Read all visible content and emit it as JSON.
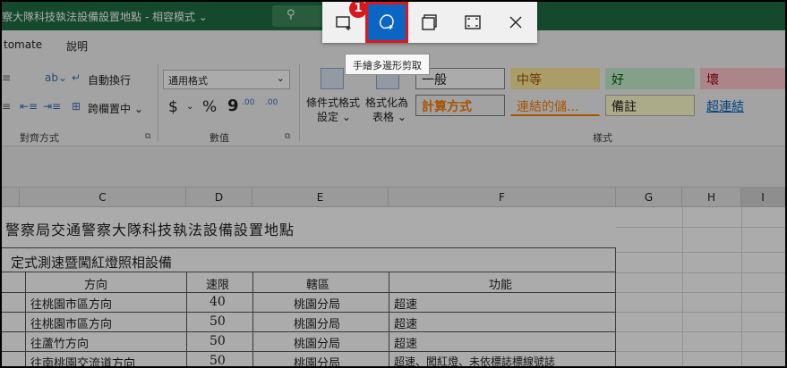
{
  "title_bar": {
    "title": "察大隊科技執法設備設置地點 - 相容模式 ⌄",
    "search_icon": "search-icon"
  },
  "menu": {
    "items": [
      "tomate",
      "說明"
    ]
  },
  "ribbon": {
    "align": {
      "wrap_text": "自動換行",
      "merge_center": "跨欄置中 ⌄",
      "group_label": "對齊方式"
    },
    "number": {
      "format_value": "通用格式",
      "currency": "$",
      "percent": "%",
      "comma": "9",
      "dec_inc": ".00",
      "dec_dec": ".00",
      "group_label": "數值"
    },
    "styles": {
      "cond_format": [
        "條件式格式",
        "設定 ⌄"
      ],
      "format_table": [
        "格式化為",
        "表格 ⌄"
      ],
      "normal": "一般",
      "neutral": "中等",
      "good": "好",
      "bad": "壞",
      "calculation": "計算方式",
      "linked_cell": "連結的儲...",
      "note": "備註",
      "hyperlink": "超連結",
      "group_label": "樣式"
    },
    "colors": {
      "neutral_bg": "#ffeb9c",
      "neutral_fg": "#9c5700",
      "good_bg": "#c6efce",
      "good_fg": "#006100",
      "bad_bg": "#ffc7ce",
      "bad_fg": "#9c0006",
      "calc_bg": "#f2f2f2",
      "calc_fg": "#fa7d00",
      "note_bg": "#ffffcc",
      "link_fg": "#0563c1"
    }
  },
  "snip_toolbar": {
    "tools": [
      "rectangle-snip-icon",
      "freeform-snip-icon",
      "window-snip-icon",
      "fullscreen-snip-icon",
      "close-icon"
    ],
    "badge": "1",
    "tooltip": "手繪多邊形剪取",
    "accent": "#0a66c2",
    "highlight": "#e2151b"
  },
  "sheet": {
    "columns": [
      "C",
      "D",
      "E",
      "F",
      "G",
      "H",
      "I"
    ],
    "title": "警察局交通警察大隊科技執法設備設置地點",
    "section": "定式測速暨闖紅燈照相設備",
    "headers": [
      "方向",
      "速限",
      "轄區",
      "功能"
    ],
    "rows": [
      [
        "往桃園市區方向",
        "40",
        "桃園分局",
        "超速"
      ],
      [
        "往桃園市區方向",
        "50",
        "桃園分局",
        "超速"
      ],
      [
        "往蘆竹方向",
        "50",
        "桃園分局",
        "超速"
      ],
      [
        "往南桃園交流道方向",
        "50",
        "桃園分局",
        "超速、闖紅燈、未依標誌標線號誌"
      ]
    ]
  }
}
